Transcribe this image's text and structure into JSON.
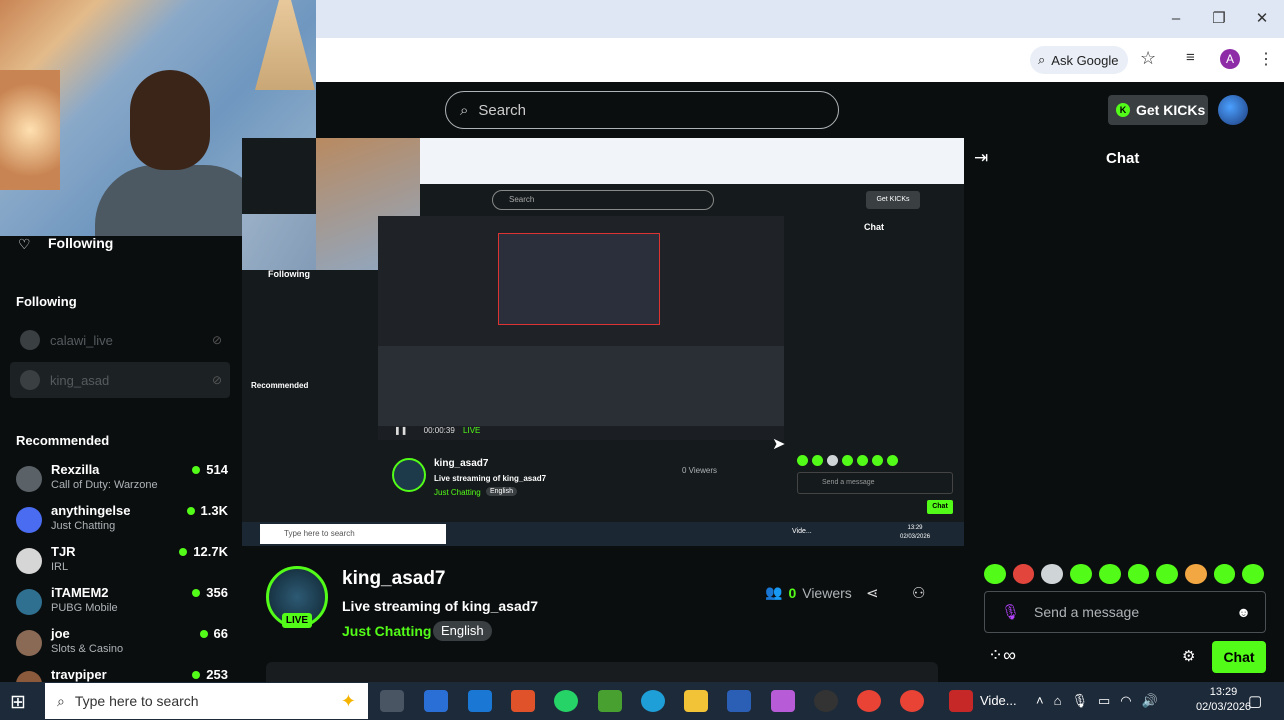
{
  "browser": {
    "ask_google": "Ask Google",
    "profile_initial": "A"
  },
  "header": {
    "search_placeholder": "Search",
    "get_kicks": "Get KICKs"
  },
  "sidebar": {
    "following_header": "Following",
    "following_section": "Following",
    "following": [
      {
        "name": "calawi_live"
      },
      {
        "name": "king_asad"
      }
    ],
    "recommended_header": "Recommended",
    "recommended": [
      {
        "name": "Rexzilla",
        "category": "Call of Duty: Warzone",
        "viewers": "514"
      },
      {
        "name": "anythingelse",
        "category": "Just Chatting",
        "viewers": "1.3K"
      },
      {
        "name": "TJR",
        "category": "IRL",
        "viewers": "12.7K"
      },
      {
        "name": "iTAMEM2",
        "category": "PUBG Mobile",
        "viewers": "356"
      },
      {
        "name": "joe",
        "category": "Slots & Casino",
        "viewers": "66"
      },
      {
        "name": "travpiper",
        "category": "",
        "viewers": "253"
      }
    ]
  },
  "nested": {
    "search": "Search",
    "get_kicks": "Get KICKs",
    "chat": "Chat",
    "following": "Following",
    "recommended": "Recommended",
    "channel": "king_asad7",
    "title": "Live streaming of king_asad7",
    "category": "Just Chatting",
    "language": "English",
    "viewers": "0 Viewers",
    "message": "Send a message",
    "chat_btn": "Chat",
    "obs_time": "00:00:39",
    "obs_live": "LIVE",
    "taskbar_search": "Type here to search",
    "taskbar_video": "Vide...",
    "taskbar_time": "13:29",
    "taskbar_date": "02/03/2026"
  },
  "stream": {
    "channel_name": "king_asad7",
    "live_badge": "LIVE",
    "title": "Live streaming of king_asad7",
    "category": "Just Chatting",
    "language": "English",
    "viewer_count": "0",
    "viewer_label": "Viewers"
  },
  "chat": {
    "title": "Chat",
    "placeholder": "Send a message",
    "send_label": "Chat"
  },
  "taskbar": {
    "search_text": "Type here to search",
    "video_label": "Vide...",
    "time": "13:29",
    "date": "02/03/2026"
  },
  "colors": {
    "kick_green": "#53fc18",
    "background": "#0b0e0f"
  }
}
